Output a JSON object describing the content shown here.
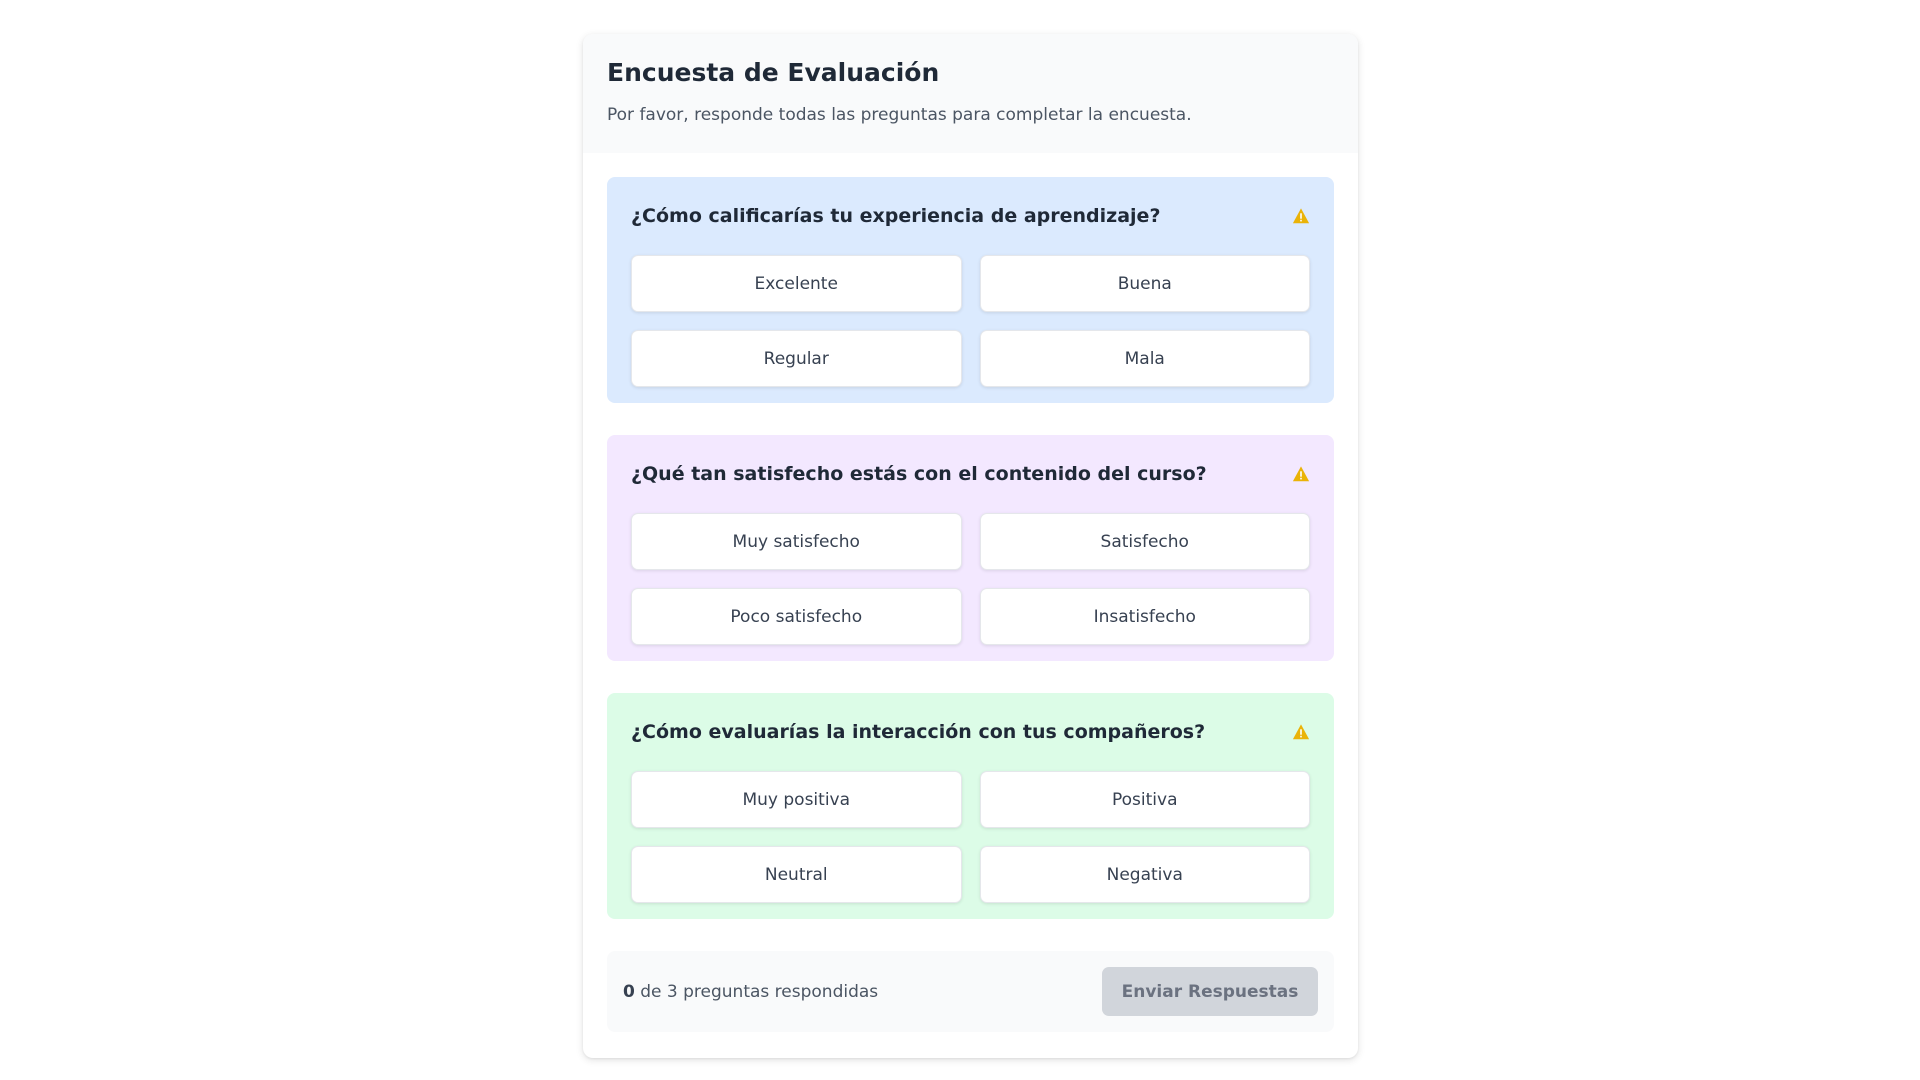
{
  "header": {
    "title": "Encuesta de Evaluación",
    "subtitle": "Por favor, responde todas las preguntas para completar la encuesta."
  },
  "questions": [
    {
      "text": "¿Cómo calificarías tu experiencia de aprendizaje?",
      "icon": "warning-icon",
      "color": "#dbeafe",
      "options": [
        "Excelente",
        "Buena",
        "Regular",
        "Mala"
      ]
    },
    {
      "text": "¿Qué tan satisfecho estás con el contenido del curso?",
      "icon": "warning-icon",
      "color": "#f3e8ff",
      "options": [
        "Muy satisfecho",
        "Satisfecho",
        "Poco satisfecho",
        "Insatisfecho"
      ]
    },
    {
      "text": "¿Cómo evaluarías la interacción con tus compañeros?",
      "icon": "warning-icon",
      "color": "#dcfce7",
      "options": [
        "Muy positiva",
        "Positiva",
        "Neutral",
        "Negativa"
      ]
    }
  ],
  "footer": {
    "answered_count": "0",
    "progress_text": " de 3 preguntas respondidas",
    "submit_label": "Enviar Respuestas"
  },
  "colors": {
    "warning": "#eab308",
    "submit_disabled": "#d1d5db"
  }
}
